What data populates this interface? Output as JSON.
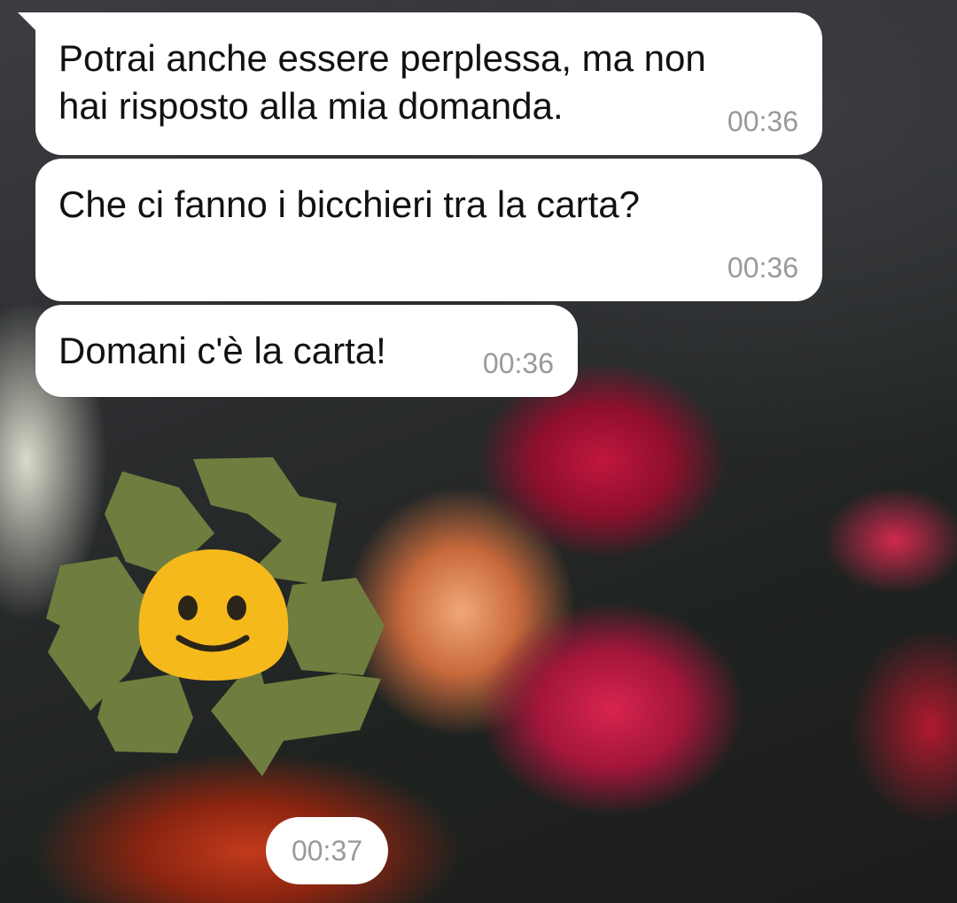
{
  "messages": [
    {
      "text": "Potrai anche essere perplessa, ma non\nhai risposto alla mia domanda.",
      "time": "00:36"
    },
    {
      "text": "Che ci fanno i bicchieri tra la carta?",
      "time": "00:36"
    },
    {
      "text": "Domani c'è la carta!",
      "time": "00:36"
    }
  ],
  "sticker": {
    "icon": "recycle-smiley-sticker",
    "time": "00:37"
  },
  "colors": {
    "bubble": "#ffffff",
    "timestamp": "#9a9a9a",
    "recycle_arrows": "#6f7d3e",
    "smiley": "#f6b91b"
  }
}
